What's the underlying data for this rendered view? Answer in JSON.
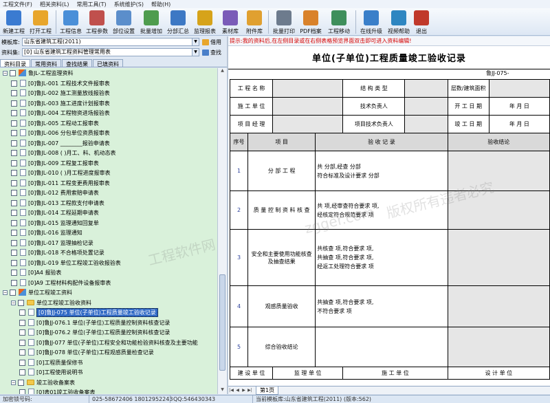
{
  "menu": [
    "工程文件(F)",
    "相关资料(L)",
    "常用工具(T)",
    "系统维护(S)",
    "帮助(H)"
  ],
  "toolbar": [
    {
      "label": "新建工程",
      "icon": "new-project-icon",
      "color": "#3b7bd1"
    },
    {
      "label": "打开工程",
      "icon": "open-folder-icon",
      "color": "#e8a62c"
    },
    {
      "label": "工程信息",
      "icon": "project-info-icon",
      "color": "#4a8fd8"
    },
    {
      "label": "工程参数",
      "icon": "project-params-icon",
      "color": "#c0504d"
    },
    {
      "label": "部位设置",
      "icon": "position-settings-icon",
      "color": "#5b8ecb"
    },
    {
      "label": "批量增加",
      "icon": "batch-add-icon",
      "color": "#4e9c4e"
    },
    {
      "label": "分部汇总",
      "icon": "summary-icon",
      "color": "#3d78c4"
    },
    {
      "label": "监理报表",
      "icon": "supervision-report-icon",
      "color": "#d6a31a"
    },
    {
      "label": "素材库",
      "icon": "material-library-icon",
      "color": "#7a5bb8"
    },
    {
      "label": "附件库",
      "icon": "attachment-library-icon",
      "color": "#e0a030"
    },
    {
      "label": "批量打印",
      "icon": "printer-icon",
      "color": "#6d7b8d"
    },
    {
      "label": "PDF档案",
      "icon": "pdf-icon",
      "color": "#d9822b"
    },
    {
      "label": "工程移动",
      "icon": "move-project-icon",
      "color": "#3e8f5c"
    },
    {
      "label": "在线升级",
      "icon": "online-upgrade-icon",
      "color": "#3a7fc9"
    },
    {
      "label": "视频帮助",
      "icon": "video-help-icon",
      "color": "#2e86c1"
    },
    {
      "label": "退出",
      "icon": "exit-icon",
      "color": "#c0392b"
    }
  ],
  "selectors": {
    "template_label": "模板库:",
    "template_value": "山东省建筑工程(2011)",
    "borrow_label": "借用",
    "dataset_label": "资料集:",
    "dataset_value": "[0] 山东省建筑工程资料管理常用表",
    "search_label": "查找"
  },
  "tabs": [
    "资料目录",
    "常用资料",
    "查找结果",
    "已填资料"
  ],
  "tree": {
    "group1": "鲁JL-工程监理资料",
    "group1_items": [
      "[0]鲁JL-001 工程技术文件报审表",
      "[0]鲁JL-002 施工测量放线报验表",
      "[0]鲁JL-003 施工进度计划报审表",
      "[0]鲁JL-004 工程物资进场报验表",
      "[0]鲁JL-005 工程动工报审表",
      "[0]鲁JL-006 分包单位资质报审表",
      "[0]鲁JL-007 ________报验申请表",
      "[0]鲁JL-008 (  )月工、料、机动态表",
      "[0]鲁JL-009 工程复工报审表",
      "[0]鲁JL-010 (  )月工程进度报审表",
      "[0]鲁JL-011 工程变更费用报审表",
      "[0]鲁JL-012 费用索赔申请表",
      "[0]鲁JL-013 工程款支付申请表",
      "[0]鲁JL-014 工程延期申请表",
      "[0]鲁JL-015 监理通知回复单",
      "[0]鲁JL-016 监理通知",
      "[0]鲁JL-017 监理抽检记录",
      "[0]鲁JL-018 不合格项处置记录",
      "[0]鲁JL-019 单位工程竣工验收报验表",
      "[0]A4 报验表",
      "[0]A9 工程材料构配件设备报审表"
    ],
    "group2": "单位工程竣工资料",
    "group2_sub": "单位工程竣工验收资料",
    "group2_items": [
      "[0]鲁JJ-075 单位(子单位)工程质量竣工验收记录",
      "[0]鲁JJ-076.1 单位(子单位)工程质量控制资料核查记录",
      "[0]鲁JJ-076.2 单位(子单位)工程质量控制资料核查记录",
      "[0]鲁JJ-077 单位(子单位)工程安全和功能检验资料核查及主要功能",
      "[0]鲁JJ-078 单位(子单位)工程观感质量检查记录",
      "[0]工程质量保修书",
      "[0]工程使用说明书"
    ],
    "group3": "竣工验收备案表",
    "group3_items": [
      "[0]表01竣工验收备案表"
    ]
  },
  "hint": "提示:我的资料后,在左侧目录或在右侧表格预览界面双击即可进入资料编辑!",
  "document": {
    "title": "单位(子单位)工程质量竣工验收记录",
    "doc_no": "鲁JJ-075-",
    "info": {
      "project_name": "工 程 名 称",
      "structure_type": "结 构 类 型",
      "floors_area": "层数/建筑面积",
      "construction_unit": "施 工 单 位",
      "tech_lead": "技术负责人",
      "start_date": "开 工 日 期",
      "pm": "项 目 经 理",
      "project_tech_lead": "项目技术负责人",
      "completion_date": "竣 工 日 期",
      "date_text": "年  月  日"
    },
    "headers": {
      "seq": "序号",
      "item": "项    目",
      "record": "验 收 记 录",
      "conclusion": "验收结论"
    },
    "rows": [
      {
        "seq": "1",
        "item": "分 部 工 程",
        "lines": [
          "共    分部,经查    分部",
          "符合标准及设计要求    分部"
        ]
      },
      {
        "seq": "2",
        "item": "质 量 控 制 资 料 核 查",
        "lines": [
          "共    项,经审查符合要求    项,",
          "经核定符合规范要求    项"
        ]
      },
      {
        "seq": "3",
        "item": "安全和主要使用功能核查及抽查结果",
        "lines": [
          "共核查    项,符合要求    项,",
          "共抽查    项,符合要求    项,",
          "经返工处理符合要求    项"
        ]
      },
      {
        "seq": "4",
        "item": "观感质量验收",
        "lines": [
          "共抽查    项,符合要求    项,",
          "不符合要求    项"
        ]
      },
      {
        "seq": "5",
        "item": "综合验收结论",
        "lines": []
      }
    ],
    "sign_units": [
      "建 设 单 位",
      "监 理 单 位",
      "施 工 单 位",
      "设 计 单 位"
    ]
  },
  "watermarks": [
    "zgger.com",
    "工程软件网",
    "版权所有违者必究"
  ],
  "sheet_tab": "第1页",
  "status": {
    "lock": "加密锁号码:",
    "phone": "025-58672406 18012952243",
    "qq": "QQ:546430343",
    "template": "当前模板库:山东省建筑工程(2011) (版本:562)"
  }
}
